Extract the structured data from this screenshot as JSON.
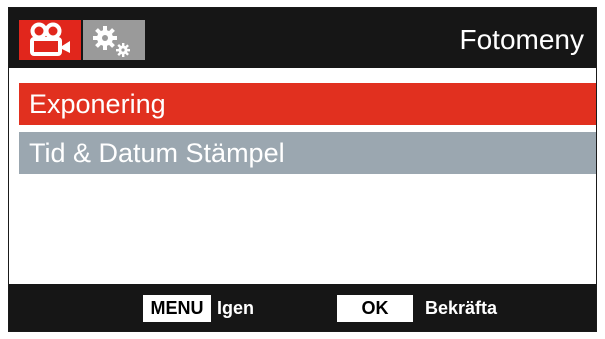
{
  "header": {
    "title": "Fotomeny",
    "tabs": [
      {
        "icon": "video-camera-icon",
        "active": true
      },
      {
        "icon": "gears-icon",
        "active": false
      }
    ]
  },
  "menu": {
    "items": [
      {
        "label": "Exponering",
        "selected": true
      },
      {
        "label": "Tid & Datum Stämpel",
        "selected": false
      }
    ]
  },
  "footer": {
    "menu_key": "MENU",
    "menu_action": "Igen",
    "ok_key": "OK",
    "ok_action": "Bekräfta"
  },
  "colors": {
    "header_bg": "#161616",
    "accent": "#e1301f",
    "item_bg": "#9ba7b0",
    "settings_tab": "#9a9a9a"
  }
}
